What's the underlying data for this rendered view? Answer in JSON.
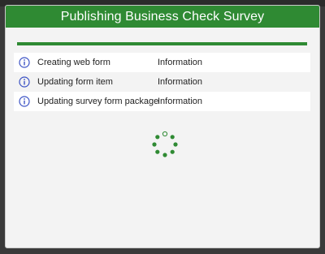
{
  "dialog": {
    "title": "Publishing Business Check Survey",
    "progress": 1.0
  },
  "log": [
    {
      "icon": "info-icon",
      "message": "Creating web form",
      "level": "Information"
    },
    {
      "icon": "info-icon",
      "message": "Updating form item",
      "level": "Information"
    },
    {
      "icon": "info-icon",
      "message": "Updating survey form package",
      "level": "Information"
    }
  ],
  "colors": {
    "accent": "#2f8a33",
    "info_icon": "#3b52c4"
  },
  "spinner": {
    "icon": "loading-spinner-icon"
  }
}
